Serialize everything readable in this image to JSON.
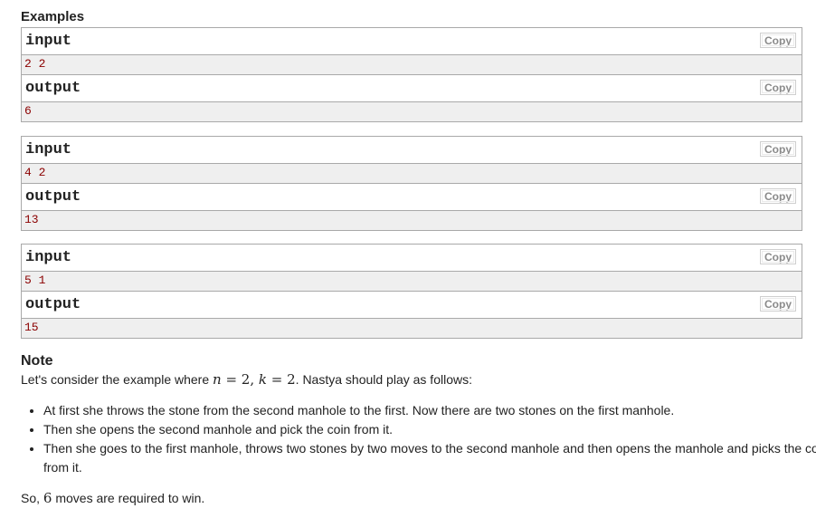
{
  "heading": "Examples",
  "copy_label": "Copy",
  "input_label": "input",
  "output_label": "output",
  "examples": [
    {
      "input": "2 2",
      "output": "6"
    },
    {
      "input": "4 2",
      "output": "13"
    },
    {
      "input": "5 1",
      "output": "15"
    }
  ],
  "note": {
    "title": "Note",
    "intro_prefix": "Let's consider the example where ",
    "n_var": "n",
    "n_val": "= 2,",
    "k_var": "k",
    "k_val": "= 2",
    "intro_suffix": ". Nastya should play as follows:",
    "steps": [
      "At first she throws the stone from the second manhole to the first. Now there are two stones on the first manhole.",
      "Then she opens the second manhole and pick the coin from it.",
      "Then she goes to the first manhole, throws two stones by two moves to the second manhole and then opens the manhole and picks the coin from it."
    ],
    "conclusion_prefix": "So, ",
    "conclusion_num": "6",
    "conclusion_suffix": " moves are required to win."
  }
}
